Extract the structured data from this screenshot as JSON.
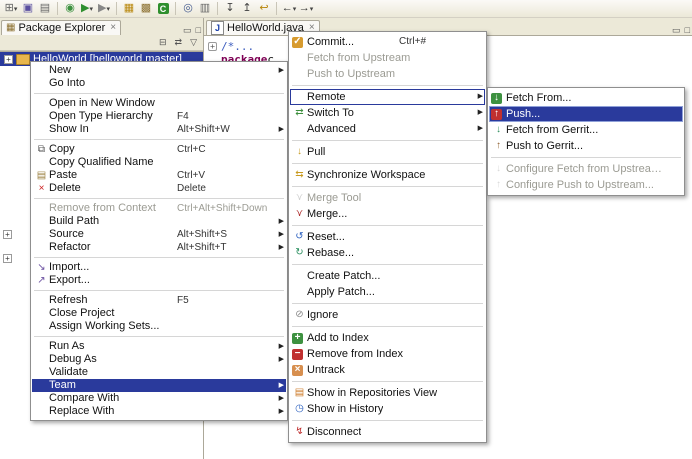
{
  "colors": {
    "selection": "#2a3a9c",
    "chrome": "#ece9d8",
    "menu_background": "#ffffff",
    "keyword": "#7f0055",
    "comment": "#3f5fbf",
    "disabled_text": "#9b9b93"
  },
  "glyphs": {
    "minimize": "▭",
    "maximize": "□",
    "close": "×",
    "view_menu": "▽",
    "collapse_all": "⊟",
    "link_editor": "⇄",
    "submenu_arrow": "▶",
    "fold_collapsed": "+",
    "expander": "+",
    "java_file": "J",
    "package_explorer": "▦"
  },
  "toolbar": {
    "groups": [
      [
        {
          "name": "new-wizard",
          "glyph": "⊞",
          "color": "#666666",
          "dropdown": true
        },
        {
          "name": "save",
          "glyph": "▣",
          "color": "#5a4fa0"
        },
        {
          "name": "print",
          "glyph": "▤",
          "color": "#666666"
        }
      ],
      [
        {
          "name": "debug",
          "glyph": "◉",
          "color": "#3d9140"
        },
        {
          "name": "run",
          "glyph": "▶",
          "color": "#2e8f2e",
          "dropdown": true
        },
        {
          "name": "external-tools",
          "glyph": "▶",
          "color": "#888888",
          "dropdown": true
        }
      ],
      [
        {
          "name": "new-java-project",
          "glyph": "▦",
          "color": "#b8860b"
        },
        {
          "name": "new-package",
          "glyph": "▩",
          "color": "#8b6f2f"
        },
        {
          "name": "new-class",
          "letter": "C",
          "bg": "#2e8f2e"
        }
      ],
      [
        {
          "name": "search",
          "glyph": "◎",
          "color": "#445a8f"
        },
        {
          "name": "tasks",
          "glyph": "▥",
          "color": "#666666"
        }
      ],
      [
        {
          "name": "next-annotation",
          "glyph": "↧",
          "color": "#444444"
        },
        {
          "name": "previous-annotation",
          "glyph": "↥",
          "color": "#444444"
        },
        {
          "name": "last-edit-location",
          "glyph": "↩",
          "color": "#b8860b"
        }
      ],
      [
        {
          "name": "back",
          "glyph": "←",
          "color": "#333333",
          "dropdown": true
        },
        {
          "name": "forward",
          "glyph": "→",
          "color": "#333333",
          "dropdown": true
        }
      ]
    ]
  },
  "explorer": {
    "tab_label": "Package Explorer",
    "selected_project": "HelloWorld [helloworld master]"
  },
  "editor": {
    "tab_label": "HelloWorld.java",
    "line1": "/*...",
    "line2_keyword": "package",
    "line2_rest": " c"
  },
  "icon_defs": {
    "copy": {
      "g": "⧉",
      "c": "#555555"
    },
    "paste": {
      "g": "▤",
      "c": "#9a7f3f"
    },
    "delete": {
      "g": "×",
      "c": "#cc2222"
    },
    "import": {
      "g": "↘",
      "c": "#6a4fa0"
    },
    "export": {
      "g": "↗",
      "c": "#6a4fa0"
    },
    "commit": {
      "g": "✓",
      "c": "#ffffff",
      "bg": "#d79b2f"
    },
    "switch": {
      "g": "⇄",
      "c": "#3d8f3d"
    },
    "pull": {
      "g": "↓",
      "c": "#c89a20"
    },
    "sync": {
      "g": "⇆",
      "c": "#c89a20"
    },
    "mergetool": {
      "g": "⋎",
      "c": "#999999"
    },
    "merge": {
      "g": "⋎",
      "c": "#b03030"
    },
    "reset": {
      "g": "↺",
      "c": "#2a5fbf"
    },
    "rebase": {
      "g": "↻",
      "c": "#2a8f5f"
    },
    "ignore": {
      "g": "⊘",
      "c": "#888888"
    },
    "add-index": {
      "g": "+",
      "c": "#ffffff",
      "bg": "#3d9140"
    },
    "remove-index": {
      "g": "−",
      "c": "#ffffff",
      "bg": "#c03030"
    },
    "untrack": {
      "g": "×",
      "c": "#ffffff",
      "bg": "#d78f4f"
    },
    "repo-view": {
      "g": "▤",
      "c": "#cc7722"
    },
    "history": {
      "g": "◷",
      "c": "#2a5fbf"
    },
    "disconnect": {
      "g": "↯",
      "c": "#c03030"
    },
    "fetch": {
      "g": "↓",
      "c": "#ffffff",
      "bg": "#3d9140"
    },
    "push": {
      "g": "↑",
      "c": "#ffffff",
      "bg": "#c03030"
    },
    "gerrit-fetch": {
      "g": "↓",
      "c": "#2f8f5f"
    },
    "gerrit-push": {
      "g": "↑",
      "c": "#8f5f2f"
    },
    "config-fetch": {
      "g": "↓",
      "c": "#aaaaaa"
    },
    "config-push": {
      "g": "↑",
      "c": "#aaaaaa"
    }
  },
  "menus": {
    "context": {
      "items": [
        {
          "label": "New",
          "submenu": true
        },
        {
          "label": "Go Into"
        },
        {
          "sep": true
        },
        {
          "label": "Open in New Window"
        },
        {
          "label": "Open Type Hierarchy",
          "shortcut": "F4"
        },
        {
          "label": "Show In",
          "shortcut": "Alt+Shift+W",
          "submenu": true
        },
        {
          "sep": true
        },
        {
          "label": "Copy",
          "shortcut": "Ctrl+C",
          "icon": "copy"
        },
        {
          "label": "Copy Qualified Name"
        },
        {
          "label": "Paste",
          "shortcut": "Ctrl+V",
          "icon": "paste"
        },
        {
          "label": "Delete",
          "shortcut": "Delete",
          "icon": "delete"
        },
        {
          "sep": true
        },
        {
          "label": "Remove from Context",
          "shortcut": "Ctrl+Alt+Shift+Down",
          "disabled": true
        },
        {
          "label": "Build Path",
          "submenu": true
        },
        {
          "label": "Source",
          "shortcut": "Alt+Shift+S",
          "submenu": true
        },
        {
          "label": "Refactor",
          "shortcut": "Alt+Shift+T",
          "submenu": true
        },
        {
          "sep": true
        },
        {
          "label": "Import...",
          "icon": "import"
        },
        {
          "label": "Export...",
          "icon": "export"
        },
        {
          "sep": true
        },
        {
          "label": "Refresh",
          "shortcut": "F5"
        },
        {
          "label": "Close Project"
        },
        {
          "label": "Assign Working Sets..."
        },
        {
          "sep": true
        },
        {
          "label": "Run As",
          "submenu": true
        },
        {
          "label": "Debug As",
          "submenu": true
        },
        {
          "label": "Validate"
        },
        {
          "label": "Team",
          "submenu": true,
          "state": "selected"
        },
        {
          "label": "Compare With",
          "submenu": true
        },
        {
          "label": "Replace With",
          "submenu": true
        }
      ]
    },
    "team": {
      "items": [
        {
          "label": "Commit...",
          "shortcut": "Ctrl+#",
          "icon": "commit"
        },
        {
          "label": "Fetch from Upstream",
          "disabled": true
        },
        {
          "label": "Push to Upstream",
          "disabled": true
        },
        {
          "sep": true
        },
        {
          "label": "Remote",
          "submenu": true,
          "state": "outline"
        },
        {
          "label": "Switch To",
          "submenu": true,
          "icon": "switch"
        },
        {
          "label": "Advanced",
          "submenu": true
        },
        {
          "sep": true
        },
        {
          "label": "Pull",
          "icon": "pull"
        },
        {
          "sep": true
        },
        {
          "label": "Synchronize Workspace",
          "icon": "sync"
        },
        {
          "sep": true
        },
        {
          "label": "Merge Tool",
          "disabled": true,
          "icon": "mergetool"
        },
        {
          "label": "Merge...",
          "icon": "merge"
        },
        {
          "sep": true
        },
        {
          "label": "Reset...",
          "icon": "reset"
        },
        {
          "label": "Rebase...",
          "icon": "rebase"
        },
        {
          "sep": true
        },
        {
          "label": "Create Patch..."
        },
        {
          "label": "Apply Patch..."
        },
        {
          "sep": true
        },
        {
          "label": "Ignore",
          "icon": "ignore"
        },
        {
          "sep": true
        },
        {
          "label": "Add to Index",
          "icon": "add-index"
        },
        {
          "label": "Remove from Index",
          "icon": "remove-index"
        },
        {
          "label": "Untrack",
          "icon": "untrack"
        },
        {
          "sep": true
        },
        {
          "label": "Show in Repositories View",
          "icon": "repo-view"
        },
        {
          "label": "Show in History",
          "icon": "history"
        },
        {
          "sep": true
        },
        {
          "label": "Disconnect",
          "icon": "disconnect"
        }
      ]
    },
    "remote": {
      "items": [
        {
          "label": "Fetch From...",
          "icon": "fetch"
        },
        {
          "label": "Push...",
          "icon": "push",
          "state": "selected"
        },
        {
          "label": "Fetch from Gerrit...",
          "icon": "gerrit-fetch"
        },
        {
          "label": "Push to Gerrit...",
          "icon": "gerrit-push"
        },
        {
          "sep": true
        },
        {
          "label": "Configure Fetch from Upstream...",
          "disabled": true,
          "icon": "config-fetch"
        },
        {
          "label": "Configure Push to Upstream...",
          "disabled": true,
          "icon": "config-push"
        }
      ]
    }
  }
}
